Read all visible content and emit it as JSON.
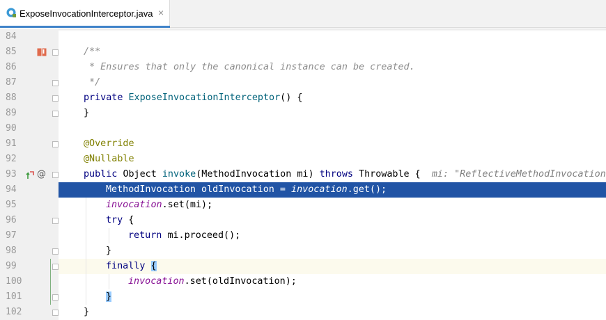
{
  "tab": {
    "filename": "ExposeInvocationInterceptor.java",
    "close": "×"
  },
  "lines": [
    {
      "num": "84"
    },
    {
      "num": "85",
      "t1": "/**"
    },
    {
      "num": "86",
      "t1": " * Ensures that only the canonical instance can be created."
    },
    {
      "num": "87",
      "t1": " */"
    },
    {
      "num": "88",
      "t1": "private ",
      "t2": "ExposeInvocationInterceptor",
      "t3": "() {"
    },
    {
      "num": "89",
      "t1": "}"
    },
    {
      "num": "90"
    },
    {
      "num": "91",
      "t1": "@Override"
    },
    {
      "num": "92",
      "t1": "@Nullable"
    },
    {
      "num": "93",
      "t1": "public ",
      "t2": "Object ",
      "t3": "invoke",
      "t4": "(MethodInvocation mi) ",
      "t5": "throws ",
      "t6": "Throwable {",
      "hint": "mi: \"ReflectiveMethodInvocation: "
    },
    {
      "num": "94",
      "t1": "MethodInvocation oldInvocation = ",
      "t2": "invocation",
      "t3": ".get();"
    },
    {
      "num": "95",
      "t1": "invocation",
      "t2": ".set(mi);"
    },
    {
      "num": "96",
      "t1": "try ",
      "t2": "{"
    },
    {
      "num": "97",
      "t1": "return ",
      "t2": "mi.proceed();"
    },
    {
      "num": "98",
      "t1": "}"
    },
    {
      "num": "99",
      "t1": "finally ",
      "t2": "{"
    },
    {
      "num": "100",
      "t1": "invocation",
      "t2": ".set(oldInvocation);"
    },
    {
      "num": "101",
      "t1": "}"
    },
    {
      "num": "102",
      "t1": "}"
    }
  ],
  "icons": {
    "line85": "bookmark-icon",
    "line93a": "override-method-icon",
    "line93b": "annotation-at-icon",
    "tab": "java-class-file-icon"
  },
  "colors": {
    "selection": "#2154a5",
    "keyword": "#000080",
    "annotation": "#808000",
    "comment": "#8c8c8c",
    "field": "#871094",
    "method": "#00627a"
  }
}
